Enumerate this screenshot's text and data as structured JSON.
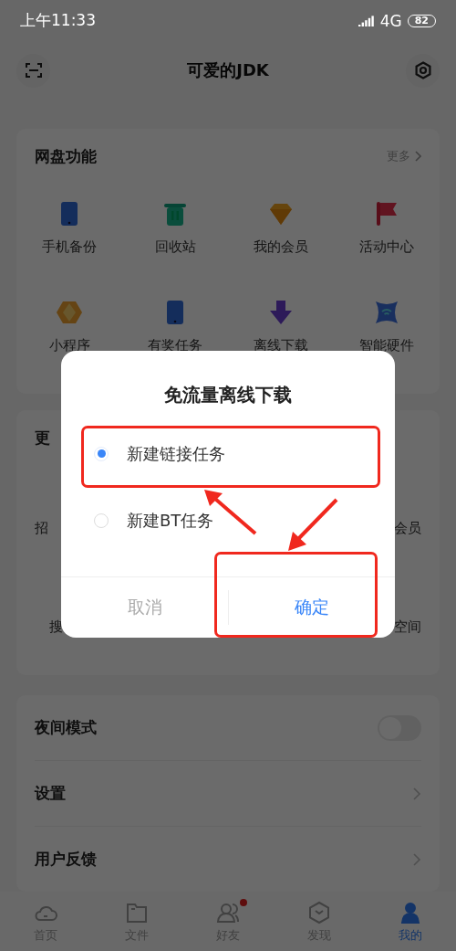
{
  "status_bar": {
    "time": "上午11:33",
    "network": "4G",
    "battery": "82"
  },
  "header": {
    "title": "可爱的JDK"
  },
  "drive_functions": {
    "title": "网盘功能",
    "more": "更多",
    "items": [
      {
        "label": "手机备份"
      },
      {
        "label": "回收站"
      },
      {
        "label": "我的会员"
      },
      {
        "label": "活动中心"
      },
      {
        "label": "小程序"
      },
      {
        "label": "有奖任务"
      },
      {
        "label": "离线下载"
      },
      {
        "label": "智能硬件"
      }
    ]
  },
  "more_section": {
    "title": "更",
    "items": [
      {
        "label": "招"
      },
      {
        "label": "会员"
      },
      {
        "label": "搜"
      },
      {
        "label": "空间"
      }
    ]
  },
  "settings": [
    {
      "kind": "toggle",
      "label": "夜间模式",
      "on": false
    },
    {
      "kind": "link",
      "label": "设置"
    },
    {
      "kind": "link",
      "label": "用户反馈"
    }
  ],
  "tabs": [
    {
      "label": "首页",
      "selected": false,
      "dot": false
    },
    {
      "label": "文件",
      "selected": false,
      "dot": false
    },
    {
      "label": "好友",
      "selected": false,
      "dot": true
    },
    {
      "label": "发现",
      "selected": false,
      "dot": false
    },
    {
      "label": "我的",
      "selected": true,
      "dot": false
    }
  ],
  "dialog": {
    "title": "免流量离线下载",
    "options": [
      {
        "label": "新建链接任务",
        "selected": true
      },
      {
        "label": "新建BT任务",
        "selected": false
      }
    ],
    "buttons": [
      {
        "label": "取消",
        "kind": "cancel"
      },
      {
        "label": "确定",
        "kind": "confirm"
      }
    ]
  }
}
